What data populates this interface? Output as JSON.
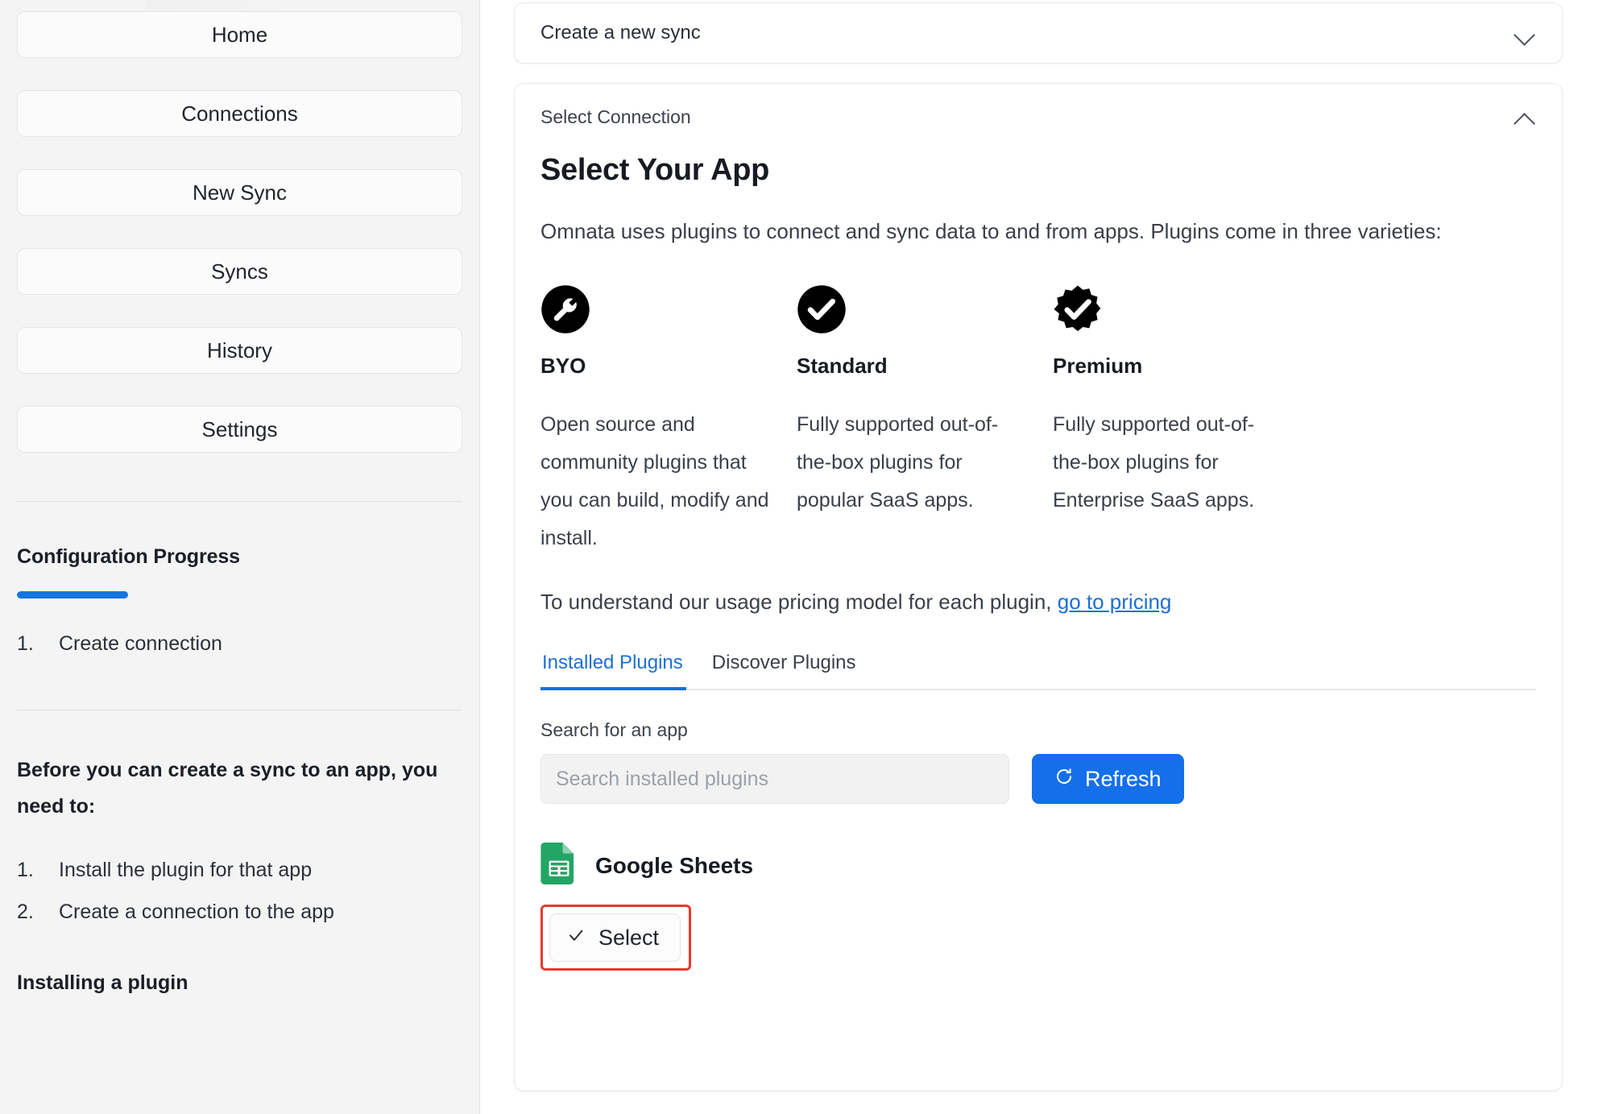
{
  "sidebar": {
    "nav_items": [
      {
        "label": "Home",
        "name": "home"
      },
      {
        "label": "Connections",
        "name": "connections"
      },
      {
        "label": "New Sync",
        "name": "new-sync"
      },
      {
        "label": "Syncs",
        "name": "syncs"
      },
      {
        "label": "History",
        "name": "history"
      },
      {
        "label": "Settings",
        "name": "settings"
      }
    ],
    "progress": {
      "heading": "Configuration Progress",
      "percent": 25,
      "steps": [
        {
          "num": "1.",
          "label": "Create connection"
        }
      ]
    },
    "prereq": {
      "heading": "Before you can create a sync to an app, you need to:",
      "steps": [
        {
          "num": "1.",
          "label": "Install the plugin for that app"
        },
        {
          "num": "2.",
          "label": "Create a connection to the app"
        }
      ]
    },
    "installing_heading": "Installing a plugin"
  },
  "main": {
    "collapsed_card": {
      "title": "Create a new sync",
      "chevron": "chevron-down-icon"
    },
    "expanded_card": {
      "label": "Select Connection",
      "chevron": "chevron-up-icon",
      "title": "Select Your App",
      "lead": "Omnata uses plugins to connect and sync data to and from apps. Plugins come in three varieties:",
      "varieties": [
        {
          "icon": "wrench-circle-icon",
          "name": "BYO",
          "desc": "Open source and community plugins that you can build, modify and install."
        },
        {
          "icon": "check-circle-icon",
          "name": "Standard",
          "desc": "Fully supported out-of-the-box plugins for popular SaaS apps."
        },
        {
          "icon": "check-badge-icon",
          "name": "Premium",
          "desc": "Fully supported out-of-the-box plugins for Enterprise SaaS apps."
        }
      ],
      "pricing_text": "To understand our usage pricing model for each plugin, ",
      "pricing_link": "go to pricing",
      "tabs": [
        {
          "label": "Installed Plugins",
          "active": true
        },
        {
          "label": "Discover Plugins",
          "active": false
        }
      ],
      "search": {
        "label": "Search for an app",
        "value": "",
        "placeholder": "Search installed plugins"
      },
      "refresh_button": {
        "label": "Refresh",
        "icon": "refresh-icon"
      },
      "plugin": {
        "icon": "google-sheets-icon",
        "name": "Google Sheets",
        "select_label": "Select",
        "select_icon": "check-icon"
      }
    }
  },
  "colors": {
    "accent_blue": "#1470ea",
    "link_blue": "#1d6fd4",
    "highlight_red": "#e8392f",
    "sheets_green": "#23a566",
    "sidebar_bg": "#f4f4f4"
  }
}
